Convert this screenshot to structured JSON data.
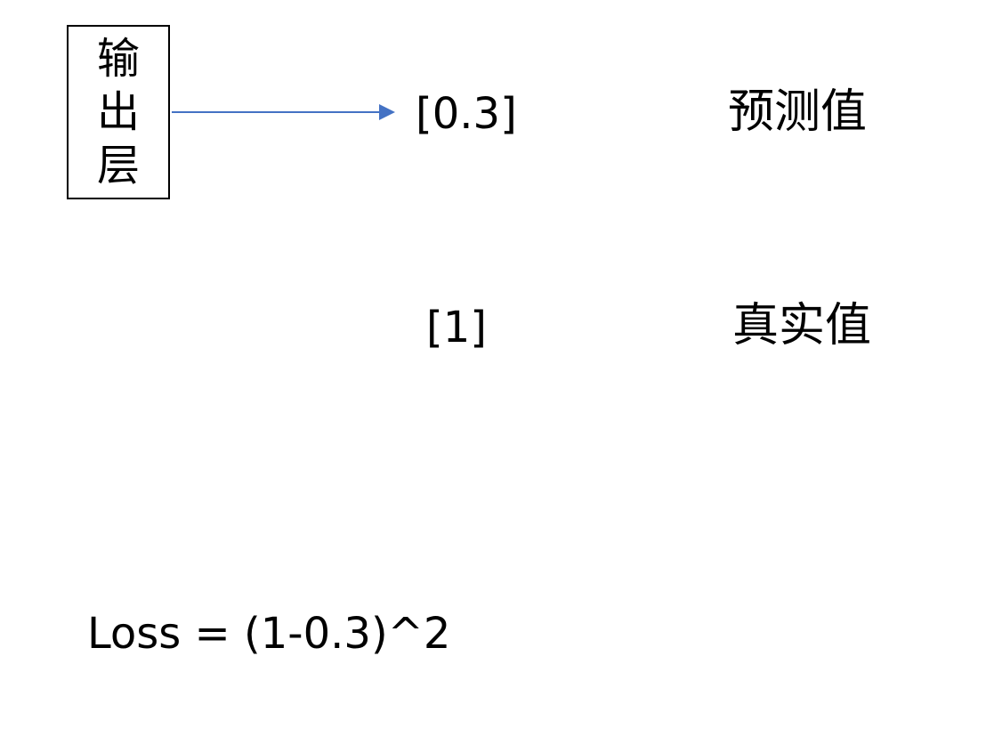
{
  "output_layer": {
    "chars": [
      "输",
      "出",
      "层"
    ]
  },
  "predicted": {
    "value": "[0.3]",
    "label": "预测值"
  },
  "true_value": {
    "value": "[1]",
    "label": "真实值"
  },
  "loss": {
    "formula": "Loss = (1-0.3)^2"
  },
  "colors": {
    "arrow": "#4472C4",
    "box_border": "#000000",
    "text": "#000000",
    "background": "#ffffff"
  }
}
